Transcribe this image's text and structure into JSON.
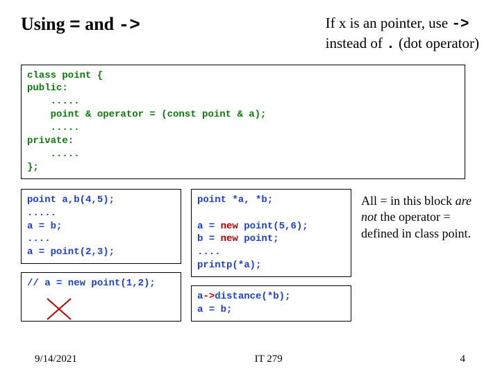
{
  "title_plain": "Using ",
  "title_eq": "=",
  "title_and": " and ",
  "title_arrow": "->",
  "note_line1a": "If x is an pointer, use ",
  "note_arrow": "->",
  "note_line2a": "instead of ",
  "note_dot": ".",
  "note_line2b": "  (dot operator)",
  "topcode": "class point {\npublic:\n    .....\n    point & operator = (const point & a);\n    .....\nprivate:\n    .....\n};",
  "leftcode1": "point a,b(4,5);\n.....\na = b;\n....\na = point(2,3);",
  "leftcode2": "// a = new point(1,2);",
  "midcode1_l1": "point *a, *b;",
  "midcode1_l2": "",
  "midcode1_l3_a": "a = ",
  "midcode1_l3_b": "new",
  "midcode1_l3_c": " point(5,6);",
  "midcode1_l4_a": "b = ",
  "midcode1_l4_b": "new",
  "midcode1_l4_c": " point;",
  "midcode1_l5": "....",
  "midcode1_l6": "printp(*a);",
  "midcode2_l1_a": "a",
  "midcode2_l1_b": "->",
  "midcode2_l1_c": "distance(*b);",
  "midcode2_l2": "a = b;",
  "rightnote_a": "All = in this block ",
  "rightnote_b": "are not",
  "rightnote_c": " the operator = defined in class point.",
  "footer_date": "9/14/2021",
  "footer_course": "IT 279",
  "footer_page": "4"
}
